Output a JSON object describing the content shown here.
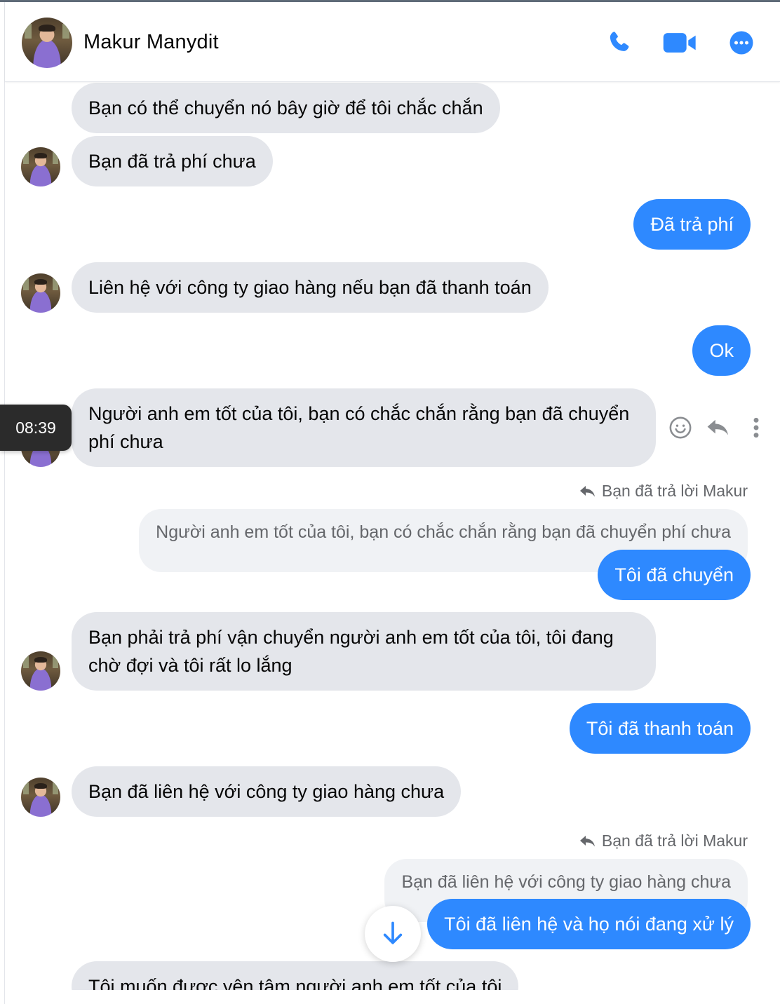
{
  "header": {
    "contact_name": "Makur Manydit",
    "icons": [
      "phone-icon",
      "video-camera-icon",
      "more-options-icon"
    ],
    "accent_color": "#2e89ff"
  },
  "tooltip": {
    "time": "08:39"
  },
  "messages": [
    {
      "from": "them",
      "text": "Bạn có thể chuyển nó bây giờ để tôi chắc chắn"
    },
    {
      "from": "them",
      "text": "Bạn đã trả phí chưa"
    },
    {
      "from": "me",
      "text": "Đã trả phí"
    },
    {
      "from": "them",
      "text": "Liên hệ với công ty giao hàng nếu bạn đã thanh toán"
    },
    {
      "from": "me",
      "text": "Ok"
    },
    {
      "from": "them",
      "text": "Người anh em tốt của tôi, bạn có chắc chắn rằng bạn đã chuyển phí chưa"
    },
    {
      "from": "me",
      "reply_label": "Bạn đã trả lời Makur",
      "quoted": "Người anh em tốt của tôi, bạn có chắc chắn rằng bạn đã chuyển phí chưa",
      "text": "Tôi đã chuyển"
    },
    {
      "from": "them",
      "text": "Bạn phải trả phí vận chuyển người anh em tốt của tôi, tôi đang chờ đợi và tôi rất lo lắng"
    },
    {
      "from": "me",
      "text": "Tôi đã thanh toán"
    },
    {
      "from": "them",
      "text": "Bạn đã liên hệ với công ty giao hàng chưa"
    },
    {
      "from": "me",
      "reply_label": "Bạn đã trả lời Makur",
      "quoted": "Bạn đã liên hệ với công ty giao hàng chưa",
      "text": "Tôi đã liên hệ và họ nói đang xử lý"
    },
    {
      "from": "them",
      "text": "Tôi muốn được yên tâm người anh em tốt của tôi"
    }
  ]
}
